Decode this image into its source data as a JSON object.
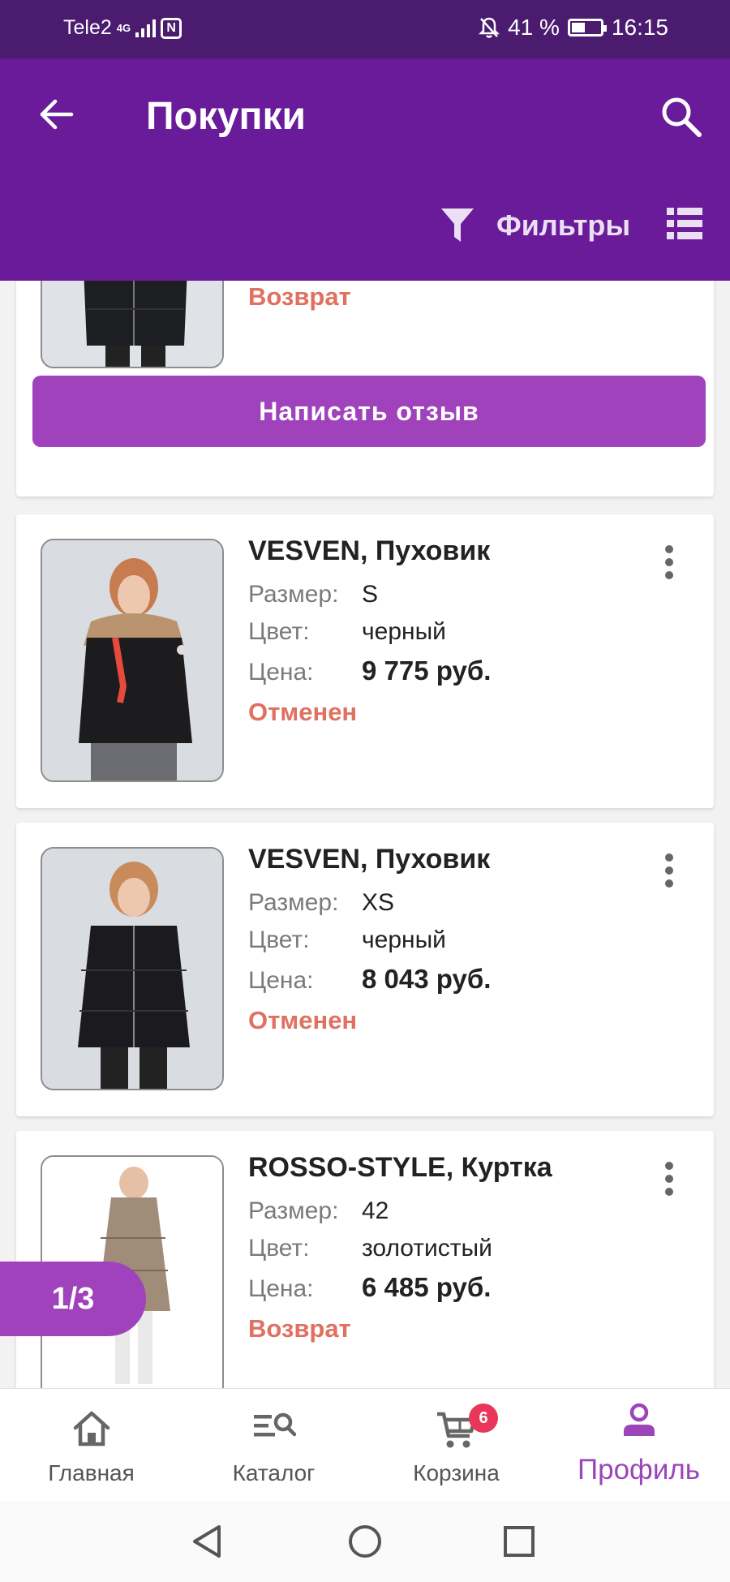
{
  "status_bar": {
    "carrier": "Tele2",
    "network": "4G",
    "battery_percent": "41 %",
    "time": "16:15"
  },
  "app_bar": {
    "title": "Покупки",
    "back_icon": "arrow-left-icon",
    "search_icon": "search-icon",
    "filter_label": "Фильтры",
    "filter_icon": "funnel-icon",
    "view_toggle_icon": "list-view-icon"
  },
  "colors": {
    "status_bar": "#4a1b6e",
    "app_bar": "#6a1b9a",
    "accent": "#a142bd",
    "status_text": "#e07060",
    "badge": "#e8375a"
  },
  "partial_card": {
    "status": "Возврат",
    "review_button": "Написать отзыв"
  },
  "labels": {
    "size": "Размер:",
    "color": "Цвет:",
    "price": "Цена:"
  },
  "orders": [
    {
      "title": "VESVEN, Пуховик",
      "size": "S",
      "color": "черный",
      "price": "9 775 руб.",
      "status": "Отменен",
      "image": "woman in black down jacket with fur hood"
    },
    {
      "title": "VESVEN, Пуховик",
      "size": "XS",
      "color": "черный",
      "price": "8 043 руб.",
      "status": "Отменен",
      "image": "woman in black quilted down jacket"
    },
    {
      "title": "ROSSO-STYLE, Куртка",
      "size": "42",
      "color": "золотистый",
      "price": "6 485 руб.",
      "status": "Возврат",
      "image": "woman in golden puffer jacket"
    }
  ],
  "pager": "1/3",
  "bottom_nav": [
    {
      "label": "Главная",
      "icon": "home-icon"
    },
    {
      "label": "Каталог",
      "icon": "catalog-search-icon"
    },
    {
      "label": "Корзина",
      "icon": "cart-icon",
      "badge": "6"
    },
    {
      "label": "Профиль",
      "icon": "profile-icon",
      "active": true
    }
  ]
}
